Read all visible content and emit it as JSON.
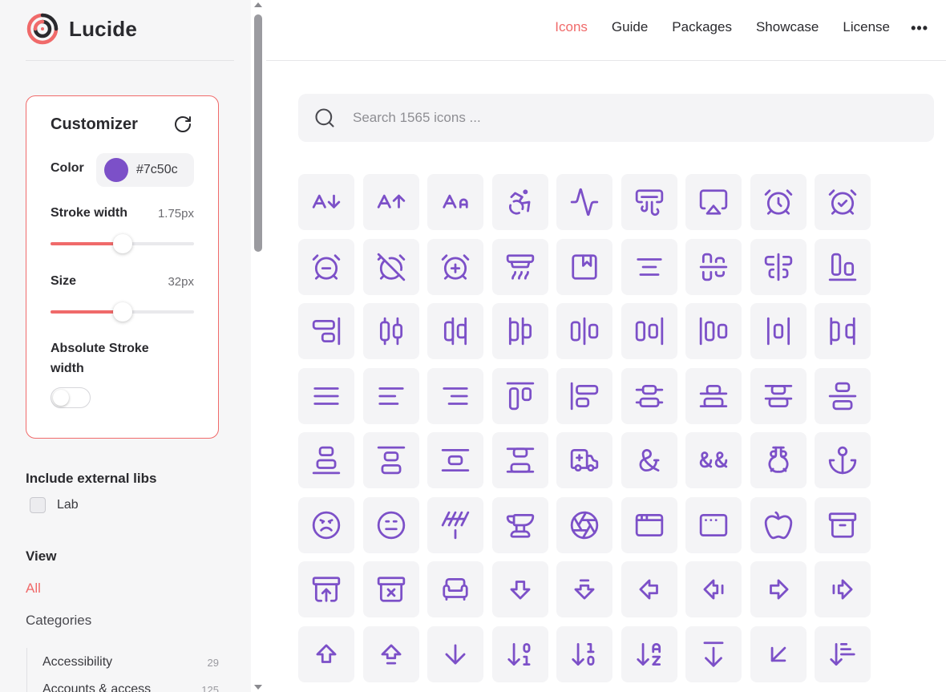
{
  "brand": {
    "name": "Lucide"
  },
  "nav": {
    "links": [
      {
        "label": "Icons",
        "active": true
      },
      {
        "label": "Guide",
        "active": false
      },
      {
        "label": "Packages",
        "active": false
      },
      {
        "label": "Showcase",
        "active": false
      },
      {
        "label": "License",
        "active": false
      }
    ],
    "more": "•••"
  },
  "customizer": {
    "title": "Customizer",
    "color_label": "Color",
    "color_hex": "#7c50c",
    "swatch_color": "#7c50c8",
    "stroke_label": "Stroke width",
    "stroke_value": "1.75px",
    "stroke_fraction": 0.5,
    "size_label": "Size",
    "size_value": "32px",
    "size_fraction": 0.5,
    "absolute_label": "Absolute Stroke width",
    "absolute_on": false
  },
  "external_libs": {
    "title": "Include external libs",
    "items": [
      {
        "label": "Lab",
        "checked": false
      }
    ]
  },
  "view": {
    "title": "View",
    "all_label": "All",
    "categories_label": "Categories",
    "categories": [
      {
        "label": "Accessibility",
        "count": "29"
      },
      {
        "label": "Accounts & access",
        "count": "125"
      }
    ]
  },
  "search": {
    "placeholder": "Search 1565 icons ..."
  },
  "colors": {
    "accent": "#f06a6a",
    "icon": "#7c50c8"
  },
  "icons": [
    "a-arrow-down",
    "a-arrow-up",
    "a-large-small",
    "accessibility",
    "activity",
    "air-vent",
    "airplay",
    "alarm-clock",
    "alarm-clock-check",
    "alarm-clock-minus",
    "alarm-clock-off",
    "alarm-clock-plus",
    "alarm-smoke",
    "album",
    "align-center",
    "align-center-horizontal",
    "align-center-vertical",
    "align-end-horizontal",
    "align-end-vertical",
    "align-horizontal-distribute-center",
    "align-horizontal-distribute-end",
    "align-horizontal-distribute-start",
    "align-horizontal-justify-center",
    "align-horizontal-justify-end",
    "align-horizontal-justify-start",
    "align-horizontal-space-around",
    "align-horizontal-space-between",
    "align-justify",
    "align-left",
    "align-right",
    "align-start-horizontal",
    "align-start-vertical",
    "align-vertical-distribute-center",
    "align-vertical-distribute-end",
    "align-vertical-distribute-start",
    "align-vertical-justify-center",
    "align-vertical-justify-end",
    "align-vertical-justify-start",
    "align-vertical-space-around",
    "align-vertical-space-between",
    "ambulance",
    "ampersand",
    "ampersands",
    "amphora",
    "anchor",
    "angry",
    "annoyed",
    "antenna",
    "anvil",
    "aperture",
    "app-window",
    "app-window-mac",
    "apple",
    "archive",
    "archive-restore",
    "archive-x",
    "armchair",
    "arrow-big-down",
    "arrow-big-down-dash",
    "arrow-big-left",
    "arrow-big-left-dash",
    "arrow-big-right",
    "arrow-big-right-dash",
    "arrow-big-up",
    "arrow-big-up-dash",
    "arrow-down",
    "arrow-down-0-1",
    "arrow-down-1-0",
    "arrow-down-a-z",
    "arrow-down-from-line",
    "arrow-down-left",
    "arrow-down-narrow-wide"
  ]
}
